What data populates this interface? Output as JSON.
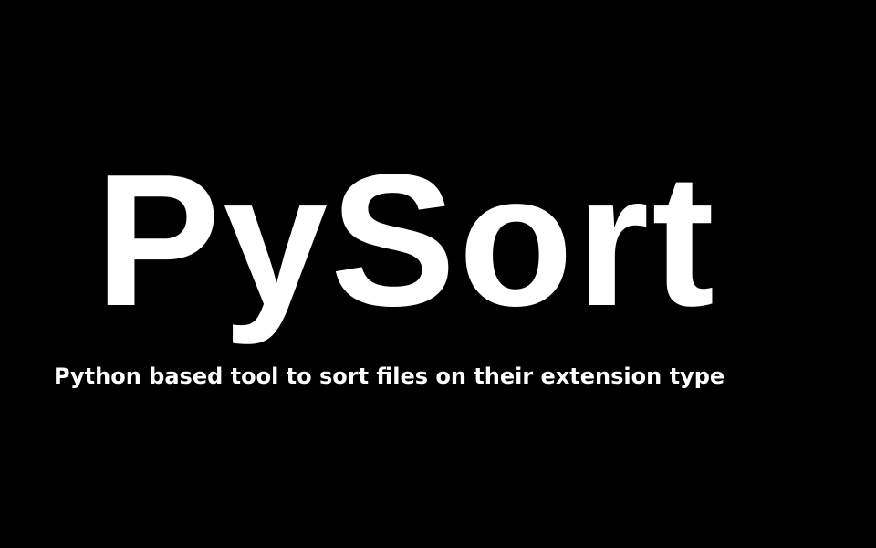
{
  "title": "PySort",
  "subtitle": "Python based tool to sort files on their extension type",
  "colors": {
    "background": "#000000",
    "text": "#ffffff"
  }
}
